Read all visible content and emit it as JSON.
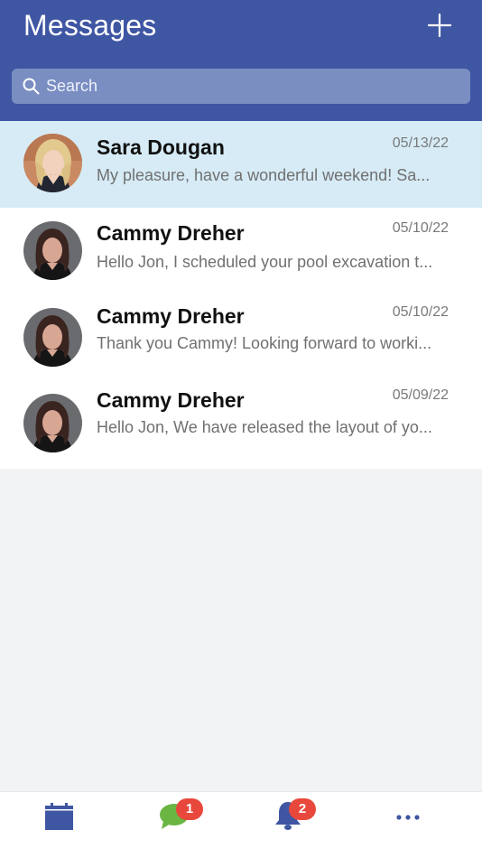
{
  "header": {
    "title": "Messages",
    "add_icon": "plus-icon"
  },
  "search": {
    "placeholder": "Search",
    "icon": "search-icon"
  },
  "conversations": [
    {
      "name": "Sara Dougan",
      "date": "05/13/22",
      "preview": "My pleasure, have a wonderful weekend!   Sa...",
      "selected": true,
      "avatar": "avatar-blonde-woman"
    },
    {
      "name": "Cammy Dreher",
      "date": "05/10/22",
      "preview": "Hello Jon,  I scheduled your pool excavation t...",
      "selected": false,
      "avatar": "avatar-dark-haired-woman"
    },
    {
      "name": "Cammy Dreher",
      "date": "05/10/22",
      "preview": "Thank you Cammy! Looking forward to worki...",
      "selected": false,
      "avatar": "avatar-dark-haired-woman"
    },
    {
      "name": "Cammy Dreher",
      "date": "05/09/22",
      "preview": "Hello Jon, We have released the layout of yo...",
      "selected": false,
      "avatar": "avatar-dark-haired-woman"
    }
  ],
  "tabbar": {
    "tabs": [
      {
        "icon": "calendar-icon",
        "badge": ""
      },
      {
        "icon": "chat-bubble-icon",
        "badge": "1"
      },
      {
        "icon": "bell-icon",
        "badge": "2"
      },
      {
        "icon": "more-dots-icon",
        "badge": ""
      }
    ]
  },
  "colors": {
    "header_bg": "#3f56a3",
    "search_bg": "#7a8ec2",
    "selected_row": "#d6ebf5",
    "badge": "#e8483b",
    "chat_icon": "#6bb543",
    "tab_icon": "#3f56a3",
    "page_bg": "#f2f3f5"
  }
}
